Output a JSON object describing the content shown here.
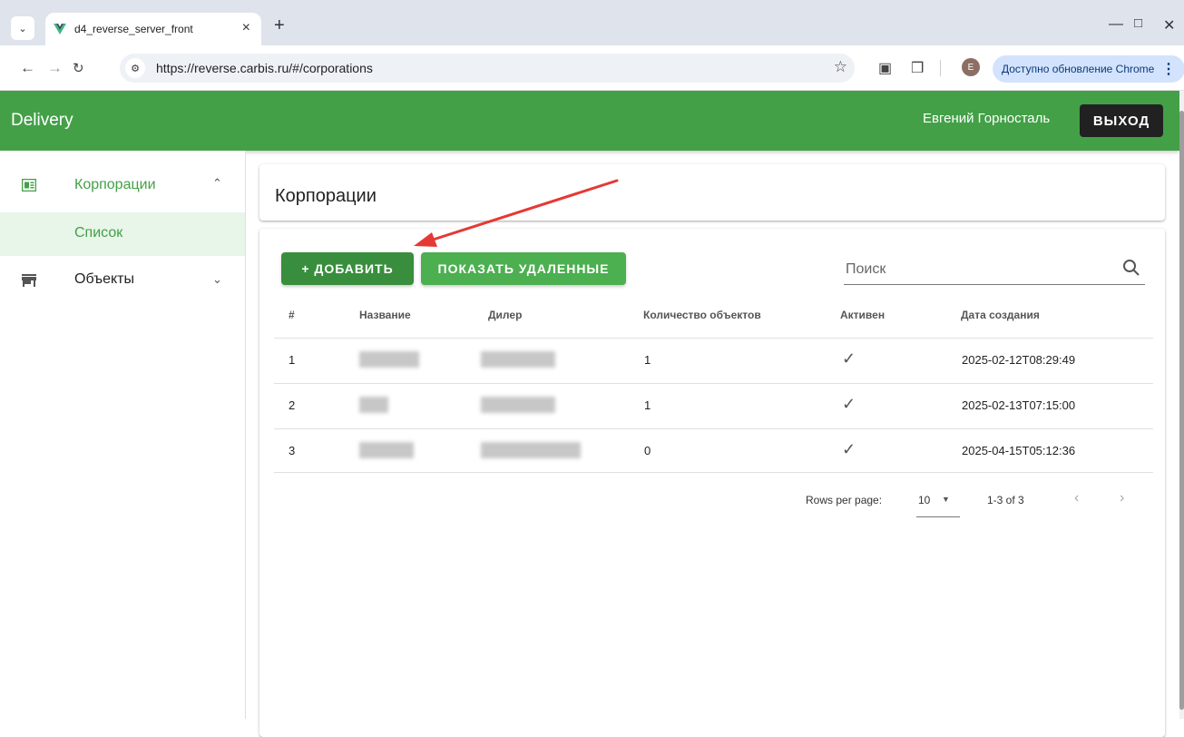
{
  "browser": {
    "tab_title": "d4_reverse_server_front",
    "url": "https://reverse.carbis.ru/#/corporations",
    "avatar_letter": "E",
    "update_label": "Доступно обновление Chrome"
  },
  "app": {
    "title": "Delivery",
    "user_name": "Евгений Горносталь",
    "logout_label": "ВЫХОД",
    "accent_color": "#43a047"
  },
  "sidebar": {
    "items": [
      {
        "label": "Корпорации",
        "icon": "newspaper-icon",
        "expanded": true
      },
      {
        "label": "Объекты",
        "icon": "store-icon",
        "expanded": false
      }
    ],
    "sub_items": [
      {
        "label": "Список",
        "selected": true
      }
    ]
  },
  "main": {
    "page_title": "Корпорации",
    "add_label": "+ ДОБАВИТЬ",
    "show_deleted_label": "ПОКАЗАТЬ УДАЛЕННЫЕ",
    "search_placeholder": "Поиск",
    "table": {
      "headers": [
        "#",
        "Название",
        "Дилер",
        "Количество объектов",
        "Активен",
        "Дата создания"
      ],
      "rows": [
        {
          "num": "1",
          "count": "1",
          "active": "✓",
          "created": "2025-02-12T08:29:49"
        },
        {
          "num": "2",
          "count": "1",
          "active": "✓",
          "created": "2025-02-13T07:15:00"
        },
        {
          "num": "3",
          "count": "0",
          "active": "✓",
          "created": "2025-04-15T05:12:36"
        }
      ]
    },
    "pagination": {
      "rows_per_page_label": "Rows per page:",
      "rows_per_page_value": "10",
      "range": "1-3 of 3"
    }
  }
}
